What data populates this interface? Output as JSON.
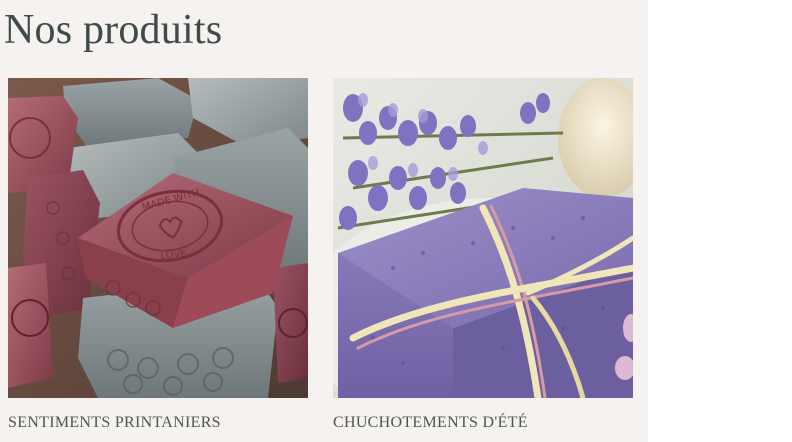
{
  "section": {
    "title": "Nos produits"
  },
  "products": [
    {
      "name": "SENTIMENTS PRINTANIERS",
      "image_desc": "soap-bars-image",
      "image_stamp": [
        "MADE WITH",
        "LOVE"
      ]
    },
    {
      "name": "CHUCHOTEMENTS D'ÉTÉ",
      "image_desc": "lavender-soap-image"
    }
  ],
  "colors": {
    "panel_bg": "#f6f2ef",
    "title": "#3f4a4b",
    "product_name": "#4d5556"
  }
}
